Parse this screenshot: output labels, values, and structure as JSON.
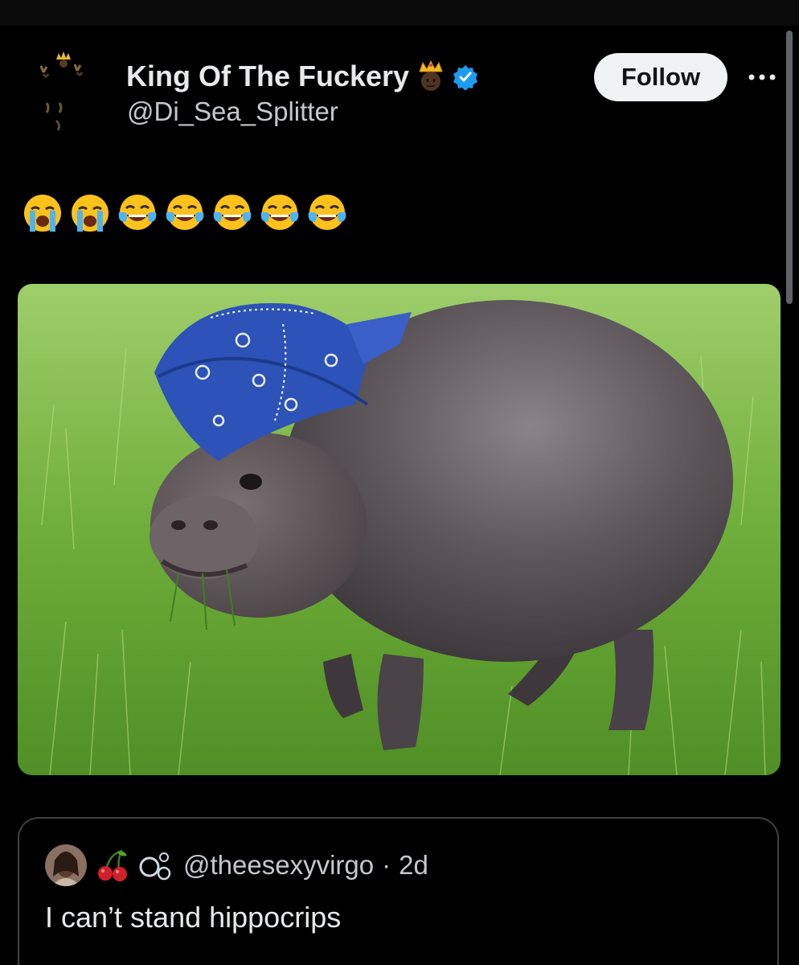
{
  "tweet": {
    "author": {
      "display_name": "King Of The Fuckery",
      "name_emoji": "crown-emoji",
      "verified": true,
      "handle": "@Di_Sea_Splitter"
    },
    "follow_label": "Follow",
    "more_icon": "more-horizontal-icon",
    "emojis": [
      "loudly-crying-face",
      "loudly-crying-face",
      "face-with-tears-of-joy",
      "face-with-tears-of-joy",
      "face-with-tears-of-joy",
      "face-with-tears-of-joy",
      "face-with-tears-of-joy"
    ],
    "media": {
      "subject": "hippo-wearing-blue-bandana"
    }
  },
  "quote": {
    "emojis": [
      "cherries-emoji",
      "bubbles-emoji"
    ],
    "handle": "@theesexyvirgo",
    "separator": "·",
    "time": "2d",
    "text": "I can’t stand hippocrips"
  },
  "colors": {
    "background": "#000000",
    "text_primary": "#e7e9ea",
    "text_secondary": "#c4c8cc",
    "verified_blue": "#1d9bf0",
    "follow_bg": "#eff3f4",
    "card_border": "#3e4144"
  }
}
